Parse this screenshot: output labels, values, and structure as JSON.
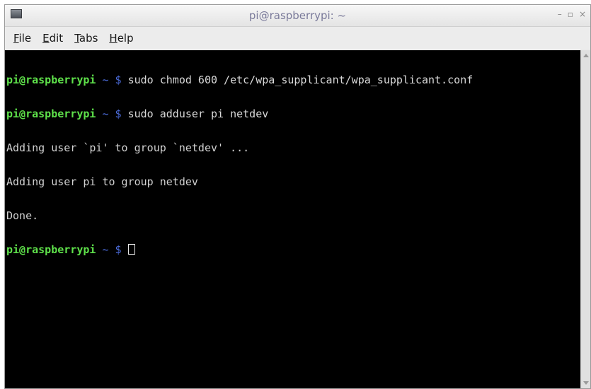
{
  "window": {
    "title": "pi@raspberrypi: ~",
    "controls": {
      "minimize": "–",
      "maximize": "▫",
      "close": "×"
    }
  },
  "menubar": {
    "items": [
      {
        "first": "F",
        "rest": "ile"
      },
      {
        "first": "E",
        "rest": "dit"
      },
      {
        "first": "T",
        "rest": "abs"
      },
      {
        "first": "H",
        "rest": "elp"
      }
    ]
  },
  "terminal": {
    "prompt_user": "pi@raspberrypi",
    "prompt_path": " ~ $ ",
    "lines": [
      {
        "type": "command",
        "text": "sudo chmod 600 /etc/wpa_supplicant/wpa_supplicant.conf"
      },
      {
        "type": "command",
        "text": "sudo adduser pi netdev"
      },
      {
        "type": "output",
        "text": "Adding user `pi' to group `netdev' ..."
      },
      {
        "type": "output",
        "text": "Adding user pi to group netdev"
      },
      {
        "type": "output",
        "text": "Done."
      },
      {
        "type": "prompt",
        "text": ""
      }
    ]
  },
  "colors": {
    "terminal_bg": "#000000",
    "prompt_user": "#5ee04a",
    "prompt_path": "#4b6bd9",
    "text": "#d9d9d9"
  }
}
